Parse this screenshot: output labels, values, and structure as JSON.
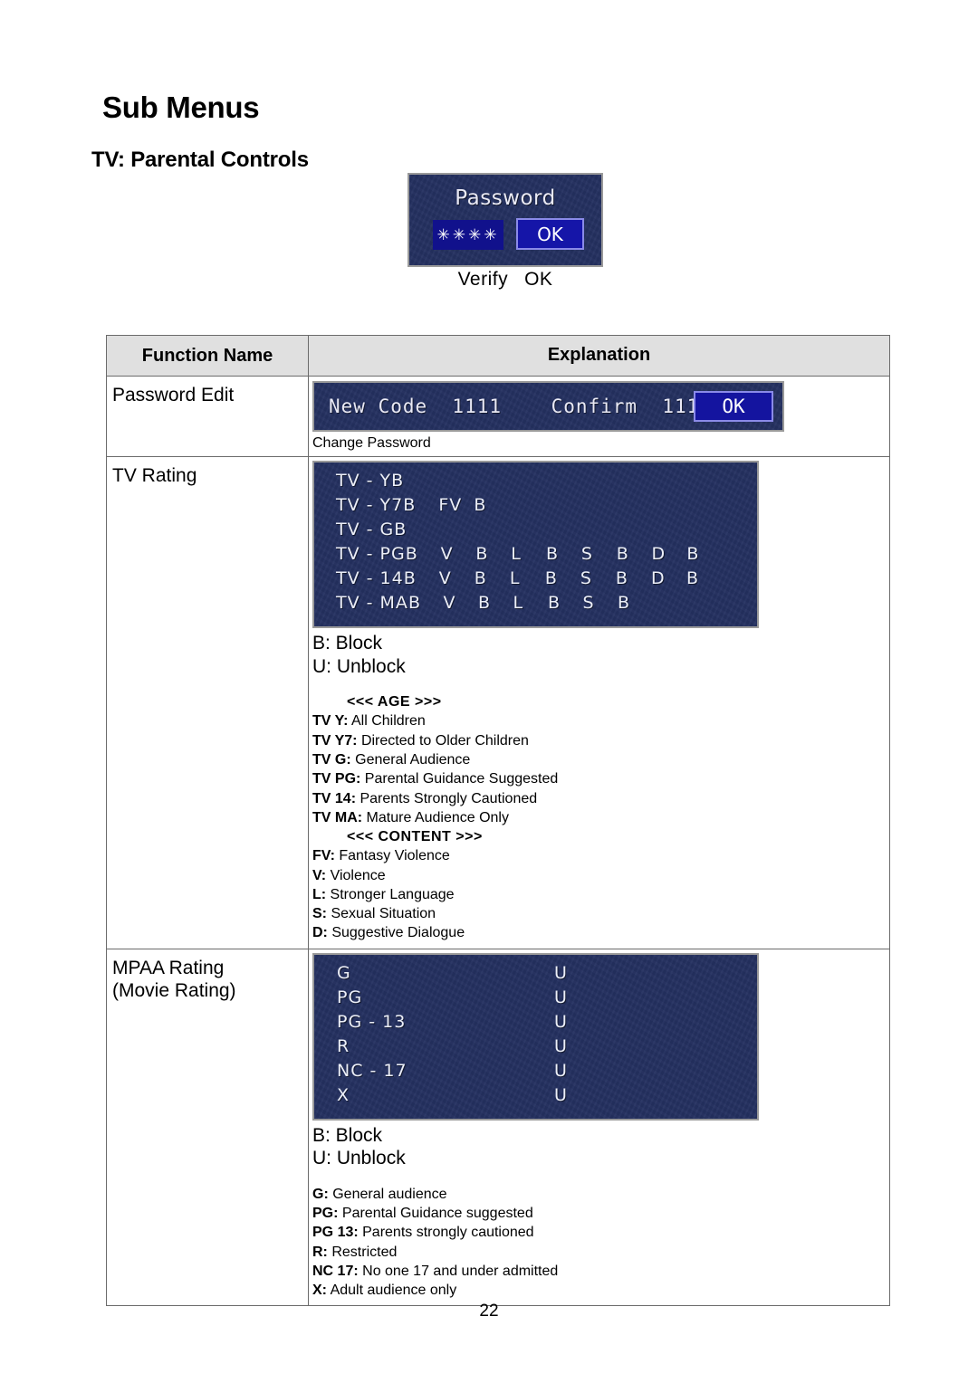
{
  "document": {
    "heading": "Sub Menus",
    "subheading": "TV: Parental Controls",
    "page_number": "22"
  },
  "password_dialog": {
    "title": "Password",
    "stars_value": "✳✳✳✳",
    "ok_label": "OK",
    "caption_verify": "Verify",
    "caption_ok": "OK"
  },
  "table": {
    "headers": {
      "function_name": "Function Name",
      "explanation": "Explanation"
    },
    "rows": {
      "password_edit": {
        "label": "Password Edit",
        "osd_line": "New Code  1111    Confirm  1111",
        "osd_ok": "OK",
        "caption": "Change Password"
      },
      "tv_rating": {
        "label": "TV Rating",
        "grid": [
          {
            "name": "TV - Y",
            "cells": [
              "B",
              "",
              "",
              "",
              "",
              "",
              "",
              "",
              "",
              ""
            ]
          },
          {
            "name": "TV - Y7",
            "cells": [
              "B",
              "FV",
              "B",
              "",
              "",
              "",
              "",
              "",
              "",
              ""
            ]
          },
          {
            "name": "TV - G",
            "cells": [
              "B",
              "",
              "",
              "",
              "",
              "",
              "",
              "",
              "",
              ""
            ]
          },
          {
            "name": "TV - PG",
            "cells": [
              "B",
              "V",
              "B",
              "L",
              "B",
              "S",
              "B",
              "D",
              "B",
              ""
            ]
          },
          {
            "name": "TV - 14",
            "cells": [
              "B",
              "V",
              "B",
              "L",
              "B",
              "S",
              "B",
              "D",
              "B",
              ""
            ]
          },
          {
            "name": "TV - MA",
            "cells": [
              "B",
              "V",
              "B",
              "L",
              "B",
              "S",
              "B",
              "",
              "",
              ""
            ]
          }
        ],
        "legend_block": "B: Block",
        "legend_unblock": "U: Unblock",
        "age_header": "<<< AGE >>>",
        "age_defs": [
          {
            "code": "TV Y:",
            "text": " All Children"
          },
          {
            "code": "TV Y7:",
            "text": " Directed to Older Children"
          },
          {
            "code": "TV G:",
            "text": " General Audience"
          },
          {
            "code": "TV PG:",
            "text": " Parental Guidance Suggested"
          },
          {
            "code": "TV 14:",
            "text": " Parents Strongly Cautioned"
          },
          {
            "code": "TV MA:",
            "text": " Mature Audience Only"
          }
        ],
        "content_header": "<<< CONTENT >>>",
        "content_defs": [
          {
            "code": "FV:",
            "text": " Fantasy Violence"
          },
          {
            "code": "V:",
            "text": " Violence"
          },
          {
            "code": "L:",
            "text": " Stronger Language"
          },
          {
            "code": "S:",
            "text": " Sexual Situation"
          },
          {
            "code": "D:",
            "text": " Suggestive Dialogue"
          }
        ]
      },
      "mpaa_rating": {
        "label_line1": "MPAA Rating",
        "label_line2": "(Movie Rating)",
        "grid": [
          {
            "name": "G",
            "value": "U"
          },
          {
            "name": "PG",
            "value": "U"
          },
          {
            "name": "PG - 13",
            "value": "U"
          },
          {
            "name": "R",
            "value": "U"
          },
          {
            "name": "NC - 17",
            "value": "U"
          },
          {
            "name": "X",
            "value": "U"
          }
        ],
        "legend_block": "B: Block",
        "legend_unblock": "U: Unblock",
        "defs": [
          {
            "code": "G:",
            "text": " General audience"
          },
          {
            "code": "PG:",
            "text": " Parental Guidance suggested"
          },
          {
            "code": "PG 13:",
            "text": " Parents strongly cautioned"
          },
          {
            "code": "R:",
            "text": " Restricted"
          },
          {
            "code": "NC 17:",
            "text": " No one 17 and under admitted"
          },
          {
            "code": "X:",
            "text": " Adult audience only"
          }
        ]
      }
    }
  },
  "colors": {
    "osd_background": "#243060",
    "osd_button": "#1515a8",
    "osd_button_border": "#8a8ae8",
    "table_header_bg": "#e0e0e0",
    "table_border": "#6b6b6b"
  }
}
